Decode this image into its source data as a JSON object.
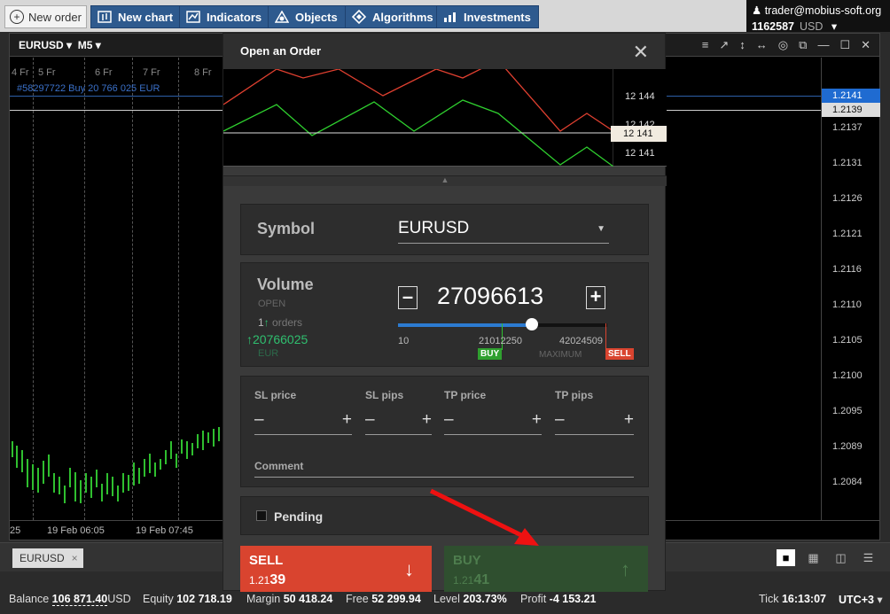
{
  "toolbar": {
    "new_order": "New order",
    "new_chart": "New chart",
    "indicators": "Indicators",
    "objects": "Objects",
    "algorithms": "Algorithms",
    "investments": "Investments"
  },
  "account": {
    "email": "trader@mobius-soft.org",
    "id": "1162587",
    "currency": "USD"
  },
  "chart": {
    "symbol": "EURUSD",
    "timeframe": "M5",
    "dates": [
      "4 Fr",
      "5 Fr",
      "6 Fr",
      "7 Fr",
      "8 Fr"
    ],
    "order_line": "#58297722 Buy 20 766 025 EUR",
    "price_labels": [
      "1.2137",
      "1.2131",
      "1.2126",
      "1.2121",
      "1.2116",
      "1.2110",
      "1.2105",
      "1.2100",
      "1.2095",
      "1.2089",
      "1.2084"
    ],
    "price_tag_blue": "1.2141",
    "price_tag_white": "1.2139",
    "time_labels": [
      "25",
      "19 Feb 06:05",
      "19 Feb 07:45"
    ]
  },
  "tabs": {
    "active": "EURUSD",
    "close": "×"
  },
  "status": {
    "balance_label": "Balance",
    "balance": "106 871.40",
    "balance_cur": "USD",
    "equity_label": "Equity",
    "equity": "102 718.19",
    "margin_label": "Margin",
    "margin": "50 418.24",
    "free_label": "Free",
    "free": "52 299.94",
    "level_label": "Level",
    "level": "203.73%",
    "profit_label": "Profit",
    "profit": "-4 153.21",
    "tick_label": "Tick",
    "tick": "16:13:07",
    "tz": "UTC+3"
  },
  "modal": {
    "title": "Open an Order",
    "mini_prices": [
      "12 144",
      "12 142",
      "12 141",
      "12 141"
    ],
    "symbol_label": "Symbol",
    "symbol_value": "EURUSD",
    "volume_label": "Volume",
    "volume_value": "27096613",
    "open_label": "OPEN",
    "orders_count": "1",
    "orders_label": "orders",
    "open_volume": "20766025",
    "open_currency": "EUR",
    "slider_min": "10",
    "slider_mid": "21012250",
    "slider_max": "42024509",
    "buy_badge": "BUY",
    "maximum_label": "MAXIMUM",
    "sell_badge": "SELL",
    "sl_price": "SL price",
    "sl_pips": "SL pips",
    "tp_price": "TP price",
    "tp_pips": "TP pips",
    "minus": "–",
    "plus": "+",
    "comment_label": "Comment",
    "pending_label": "Pending",
    "sell_label": "SELL",
    "sell_price_a": "1.21",
    "sell_price_b": "39",
    "buy_label": "BUY",
    "buy_price_a": "1.21",
    "buy_price_b": "41"
  },
  "colors": {
    "sell": "#d9442f",
    "buy": "#2f4f2f",
    "accent": "#2c7bd1"
  }
}
